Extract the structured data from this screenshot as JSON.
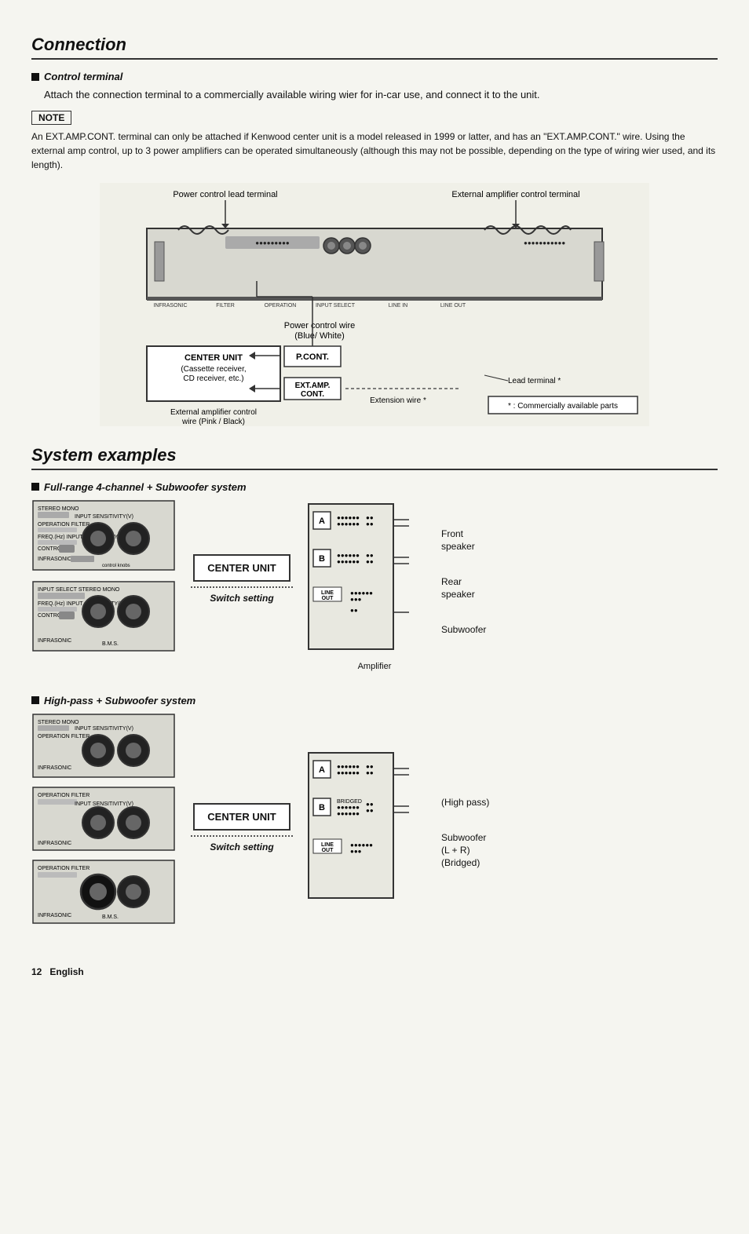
{
  "page": {
    "sections": {
      "connection": {
        "title": "Connection",
        "control_terminal": {
          "label": "Control terminal",
          "body": "Attach the connection terminal to a commercially available wiring wier for in-car use, and connect it to the unit."
        },
        "note": {
          "label": "NOTE",
          "text": "An EXT.AMP.CONT. terminal can only be attached if Kenwood center unit is a model released in 1999 or latter, and has an \"EXT.AMP.CONT.\" wire.  Using the external amp control, up to 3 power amplifiers can be operated simultaneously (although this may not be possible, depending on the type of wiring wier used, and its length)."
        },
        "diagram_labels": {
          "power_control_lead": "Power control lead terminal",
          "external_amp_control": "External amplifier control terminal",
          "power_control_wire": "Power control wire\n(Blue/ White)",
          "pcont": "P.CONT.",
          "extamp": "EXT.AMP.\nCONT.",
          "ext_amp_wire": "External amplifier control\nwire (Pink / Black)",
          "extension_wire": "Extension wire *",
          "lead_terminal": "Lead terminal *",
          "commercially": "* : Commercially available parts",
          "center_unit_label": "CENTER UNIT\n(Cassette receiver,\nCD receiver, etc.)"
        }
      },
      "system_examples": {
        "title": "System examples",
        "full_range": {
          "label": "Full-range 4-channel + Subwoofer system",
          "center_unit": "CENTER UNIT",
          "switch_setting": "Switch setting",
          "amplifier_label": "Amplifier",
          "channel_a": "A",
          "channel_b": "B",
          "line_out": "LINE\nOUT",
          "speakers": {
            "front": "Front\nspeaker",
            "rear": "Rear\nspeaker",
            "subwoofer": "Subwoofer"
          }
        },
        "high_pass": {
          "label": "High-pass + Subwoofer system",
          "center_unit": "CENTER UNIT",
          "switch_setting": "Switch setting",
          "channel_a": "A",
          "channel_b": "B",
          "line_out": "LINE\nOUT",
          "speakers": {
            "high_pass": "(High pass)",
            "subwoofer": "Subwoofer\n(L + R)\n(Bridged)"
          }
        }
      }
    },
    "footer": {
      "page_number": "12",
      "language": "English"
    }
  }
}
